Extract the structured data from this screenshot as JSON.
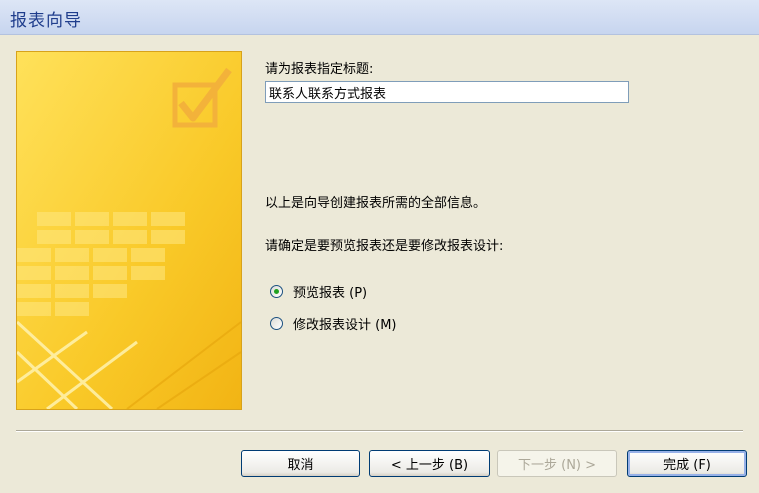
{
  "window": {
    "title": "报表向导"
  },
  "prompt_title": "请为报表指定标题:",
  "report_title_value": "联系人联系方式报表",
  "info_text": "以上是向导创建报表所需的全部信息。",
  "choice_prompt": "请确定是要预览报表还是要修改报表设计:",
  "options": [
    {
      "label": "预览报表 (P)",
      "selected": true
    },
    {
      "label": "修改报表设计 (M)",
      "selected": false
    }
  ],
  "buttons": {
    "cancel": "取消",
    "back": "< 上一步 (B)",
    "next": "下一步 (N) >",
    "finish": "完成 (F)"
  },
  "colors": {
    "accent_radio": "#21A121",
    "title_text": "#1F3D8C",
    "art_yellow": "#F7C822"
  }
}
